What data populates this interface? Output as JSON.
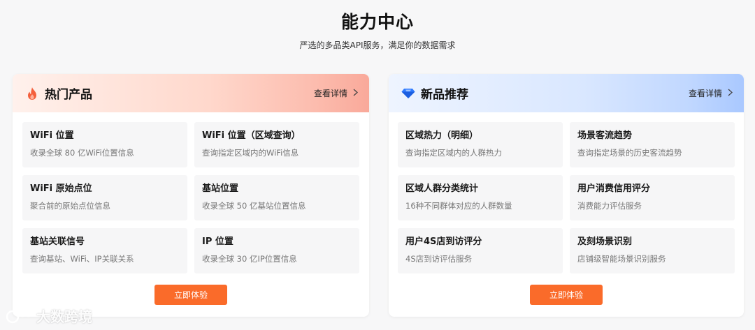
{
  "header": {
    "title": "能力中心",
    "subtitle": "严选的多品类API服务，满足你的数据需求"
  },
  "hot_card": {
    "title": "热门产品",
    "icon": "flame-icon",
    "details_label": "查看详情",
    "items": [
      {
        "title": "WiFi 位置",
        "desc": "收录全球 80 亿WiFi位置信息"
      },
      {
        "title": "WiFi 位置（区域查询）",
        "desc": "查询指定区域内的WiFi信息"
      },
      {
        "title": "WiFi 原始点位",
        "desc": "聚合前的原始点位信息"
      },
      {
        "title": "基站位置",
        "desc": "收录全球 50 亿基站位置信息"
      },
      {
        "title": "基站关联信号",
        "desc": "查询基站、WiFi、IP关联关系"
      },
      {
        "title": "IP 位置",
        "desc": "收录全球 30 亿IP位置信息"
      }
    ],
    "button_label": "立即体验"
  },
  "new_card": {
    "title": "新品推荐",
    "icon": "diamond-icon",
    "details_label": "查看详情",
    "items": [
      {
        "title": "区域热力（明细）",
        "desc": "查询指定区域内的人群热力"
      },
      {
        "title": "场景客流趋势",
        "desc": "查询指定场景的历史客流趋势"
      },
      {
        "title": "区域人群分类统计",
        "desc": "16种不同群体对应的人群数量"
      },
      {
        "title": "用户消费信用评分",
        "desc": "消费能力评估服务"
      },
      {
        "title": "用户4S店到访评分",
        "desc": "4S店到访评估服务"
      },
      {
        "title": "及刻场景识别",
        "desc": "店铺级智能场景识别服务"
      }
    ],
    "button_label": "立即体验"
  },
  "watermark": {
    "text": "大数跨境"
  },
  "colors": {
    "accent": "#fa6b2a",
    "hot_gradient_end": "#f9a99a",
    "new_gradient_end": "#a9c8ff"
  }
}
